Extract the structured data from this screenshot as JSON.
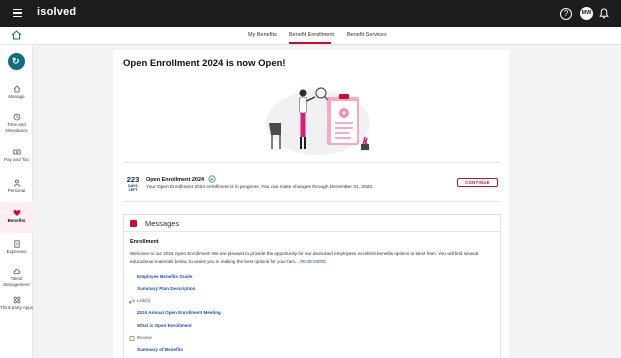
{
  "header": {
    "brand": "isolved",
    "help_icon": "question-circle-icon",
    "avatar_initials": "MW",
    "bell_icon": "bell-icon"
  },
  "subnav": {
    "tabs": [
      {
        "label": "My Benefits",
        "active": false
      },
      {
        "label": "Benefit Enrollment",
        "active": true
      },
      {
        "label": "Benefit Services",
        "active": false
      }
    ]
  },
  "sidebar": {
    "items": [
      {
        "label": "Manage",
        "icon": "home-icon"
      },
      {
        "label": "Time and Attendance",
        "icon": "clock-icon"
      },
      {
        "label": "Pay and Tax",
        "icon": "money-icon"
      },
      {
        "label": "Personal",
        "icon": "person-icon"
      },
      {
        "label": "Benefits",
        "icon": "heart-icon",
        "active": true
      },
      {
        "label": "Expenses",
        "icon": "receipt-icon"
      },
      {
        "label": "Talent Management",
        "icon": "cloud-icon"
      },
      {
        "label": "Third-party Apps",
        "icon": "apps-icon"
      }
    ]
  },
  "main": {
    "title": "Open Enrollment 2024 is now Open!",
    "countdown": {
      "number": "223",
      "label": "DAYS LEFT"
    },
    "enrollment_title": "Open Enrollment 2024",
    "enrollment_desc": "Your Open Enrollment 2024 enrollment is in progress. You can make changes through December 31, 2023.",
    "continue_label": "CONTINUE"
  },
  "messages": {
    "title": "Messages",
    "section": "Enrollment",
    "body": "Welcome to our 2024 Open Enrollment! We are pleased to provide the opportunity for our dedicated employees excellent benefits options to elect from. You will find several educational materials below, to assist you in making the best options for your fam...",
    "read_more": "READ MORE",
    "links": [
      {
        "label": "Employee Benefits Guide"
      },
      {
        "label": "Summary Plan Description"
      }
    ],
    "group1": "Link(s)",
    "links2": [
      {
        "label": "2024 Annual Open Enrollment Meeting"
      },
      {
        "label": "What is Open Enrollment"
      }
    ],
    "group2": "Review",
    "links3": [
      {
        "label": "Summary of Benefits"
      }
    ]
  },
  "colors": {
    "accent": "#c8102e",
    "topbar": "#1d1d1f",
    "link": "#1f4fbf",
    "countdown": "#1b2a6b"
  }
}
